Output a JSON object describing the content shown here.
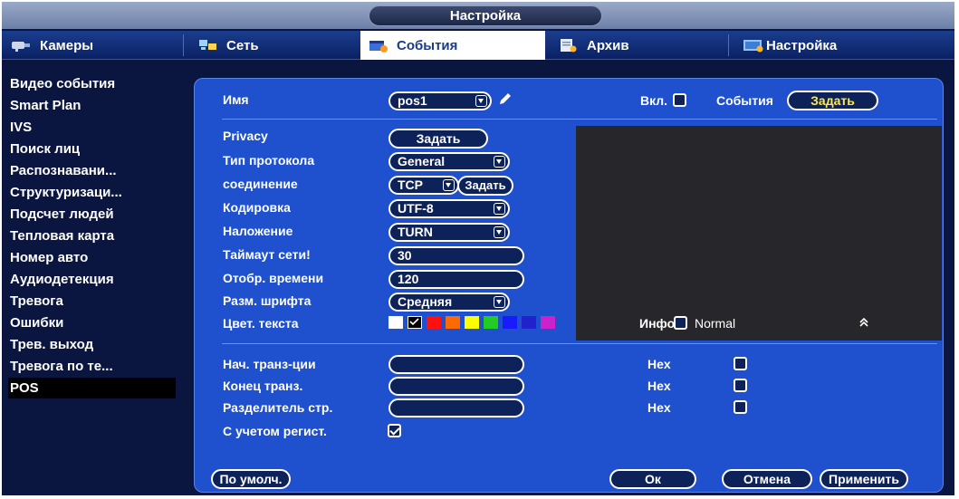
{
  "window": {
    "title": "Настройка"
  },
  "tabs": [
    {
      "label": "Камеры",
      "icon": "camera-icon"
    },
    {
      "label": "Сеть",
      "icon": "network-icon"
    },
    {
      "label": "События",
      "icon": "events-icon"
    },
    {
      "label": "Архив",
      "icon": "archive-icon"
    },
    {
      "label": "Настройка",
      "icon": "settings-icon"
    }
  ],
  "sidebar": {
    "items": [
      {
        "label": "Видео события"
      },
      {
        "label": "Smart Plan"
      },
      {
        "label": "IVS"
      },
      {
        "label": "Поиск лиц"
      },
      {
        "label": "Распознавани..."
      },
      {
        "label": "Структуризаци..."
      },
      {
        "label": "Подсчет людей"
      },
      {
        "label": "Тепловая карта"
      },
      {
        "label": "Номер авто"
      },
      {
        "label": "Аудиодетекция"
      },
      {
        "label": "Тревога"
      },
      {
        "label": "Ошибки"
      },
      {
        "label": "Трев. выход"
      },
      {
        "label": "Тревога по те..."
      },
      {
        "label": "POS"
      }
    ],
    "active": "POS"
  },
  "form": {
    "name_label": "Имя",
    "name_value": "pos1",
    "enable_label": "Вкл.",
    "events_label": "События",
    "events_button": "Задать",
    "privacy_label": "Privacy",
    "privacy_button": "Задать",
    "protocol_label": "Тип протокола",
    "protocol_value": "General",
    "connection_label": "соединение",
    "connection_value": "TCP",
    "connection_button": "Задать",
    "encoding_label": "Кодировка",
    "encoding_value": "UTF-8",
    "overlay_label": "Наложение",
    "overlay_value": "TURN",
    "timeout_label": "Таймаут сети!",
    "timeout_value": "30",
    "display_time_label": "Отобр. времени",
    "display_time_value": "120",
    "font_size_label": "Разм. шрифта",
    "font_size_value": "Средняя",
    "text_color_label": "Цвет. текста",
    "text_colors": [
      "#ffffff",
      "#000000",
      "#ff1010",
      "#ff6a00",
      "#ffff00",
      "#22cc22",
      "#1a1aff",
      "#2222cc",
      "#cc22cc"
    ],
    "info_label": "Инфо",
    "normal_label": "Normal",
    "start_label": "Нач. транз-ции",
    "end_label": "Конец транз.",
    "separator_label": "Разделитель стр.",
    "hex_label": "Hex",
    "case_label": "С учетом регист."
  },
  "footer": {
    "default_button": "По умолч.",
    "ok_button": "Ок",
    "cancel_button": "Отмена",
    "apply_button": "Применить"
  }
}
